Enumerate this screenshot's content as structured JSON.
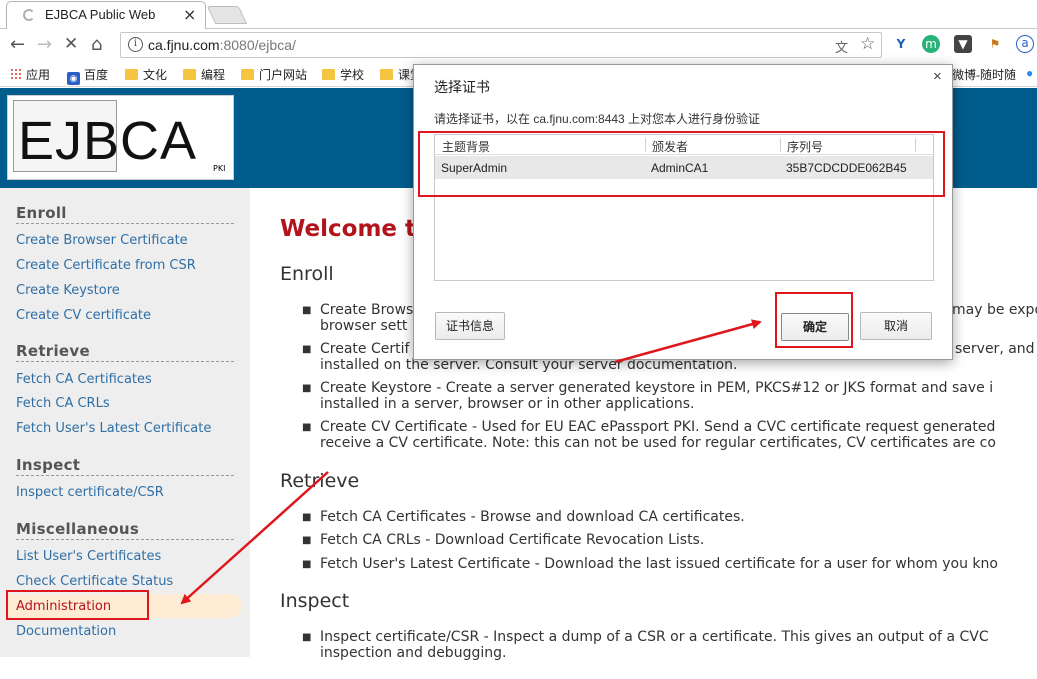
{
  "browser": {
    "tab_title": "EJBCA Public Web",
    "tab_close": "×",
    "url_host": "ca.fjnu.com",
    "url_rest": ":8080/ejbca/",
    "bookmarks": [
      "应用",
      "百度",
      "文化",
      "编程",
      "门户网站",
      "学校",
      "课堂",
      "微博-随时随"
    ]
  },
  "header": {
    "logo_text": "EJBCA",
    "logo_sub": "PKI"
  },
  "sidebar": {
    "sections": [
      {
        "title": "Enroll",
        "items": [
          "Create Browser Certificate",
          "Create Certificate from CSR",
          "Create Keystore",
          "Create CV certificate"
        ]
      },
      {
        "title": "Retrieve",
        "items": [
          "Fetch CA Certificates",
          "Fetch CA CRLs",
          "Fetch User's Latest Certificate"
        ]
      },
      {
        "title": "Inspect",
        "items": [
          "Inspect certificate/CSR"
        ]
      },
      {
        "title": "Miscellaneous",
        "items": [
          "List User's Certificates",
          "Check Certificate Status",
          "Administration",
          "Documentation"
        ]
      }
    ]
  },
  "main": {
    "welcome": "Welcome to",
    "enroll_heading": "Enroll",
    "enroll_lines": [
      "Create Brows",
      "browser sett",
      "Create Certif",
      "installed on the server. Consult your server documentation.",
      "Create Keystore - Create a server generated keystore in PEM, PKCS#12 or JKS format and save i",
      "installed in a server, browser or in other applications.",
      "Create CV Certificate - Used for EU EAC ePassport PKI. Send a CVC certificate request generated",
      "receive a CV certificate. Note: this can not be used for regular certificates, CV certificates are co"
    ],
    "enroll_tails": [
      "may be expo",
      "server, and"
    ],
    "retrieve_heading": "Retrieve",
    "retrieve_lines": [
      "Fetch CA Certificates - Browse and download CA certificates.",
      "Fetch CA CRLs - Download Certificate Revocation Lists.",
      "Fetch User's Latest Certificate - Download the last issued certificate for a user for whom you kno"
    ],
    "inspect_heading": "Inspect",
    "inspect_lines": [
      "Inspect certificate/CSR - Inspect a dump of a CSR or a certificate. This gives an output of a CVC",
      "inspection and debugging."
    ]
  },
  "dialog": {
    "title": "选择证书",
    "close": "×",
    "prompt": "请选择证书，以在 ca.fjnu.com:8443 上对您本人进行身份验证",
    "columns": [
      "主题背景",
      "颁发者",
      "序列号"
    ],
    "row": {
      "subject": "SuperAdmin",
      "issuer": "AdminCA1",
      "serial": "35B7CDCDDE062B45"
    },
    "cert_info_button": "证书信息",
    "ok_button": "确定",
    "cancel_button": "取消"
  },
  "colors": {
    "header_blue": "#005c8c",
    "link": "#2f6fa6",
    "welcome_red": "#b3141b",
    "annotation_red": "#e0161d"
  }
}
